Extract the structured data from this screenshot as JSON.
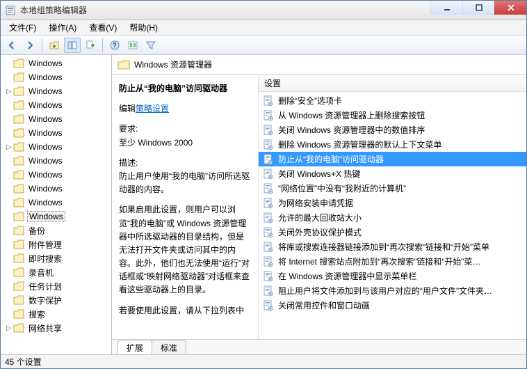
{
  "window": {
    "title": "本地组策略编辑器"
  },
  "menu": {
    "file": "文件(F)",
    "action": "操作(A)",
    "view": "查看(V)",
    "help": "帮助(H)"
  },
  "tree": {
    "items": [
      {
        "label": "Windows",
        "exp": ""
      },
      {
        "label": "Windows",
        "exp": ""
      },
      {
        "label": "Windows",
        "exp": "▷"
      },
      {
        "label": "Windows",
        "exp": ""
      },
      {
        "label": "Windows",
        "exp": ""
      },
      {
        "label": "Windows",
        "exp": ""
      },
      {
        "label": "Windows",
        "exp": "▷"
      },
      {
        "label": "Windows",
        "exp": ""
      },
      {
        "label": "Windows",
        "exp": ""
      },
      {
        "label": "Windows",
        "exp": ""
      },
      {
        "label": "Windows",
        "exp": ""
      },
      {
        "label": "Windows",
        "exp": "",
        "selected": true
      },
      {
        "label": "备份",
        "exp": ""
      },
      {
        "label": "附件管理",
        "exp": ""
      },
      {
        "label": "即时搜索",
        "exp": ""
      },
      {
        "label": "录音机",
        "exp": ""
      },
      {
        "label": "任务计划",
        "exp": ""
      },
      {
        "label": "数字保护",
        "exp": ""
      },
      {
        "label": "搜索",
        "exp": ""
      },
      {
        "label": "网络共享",
        "exp": "▷"
      }
    ]
  },
  "header": {
    "title": "Windows 资源管理器"
  },
  "desc": {
    "title": "防止从“我的电脑”访问驱动器",
    "edit_prefix": "编辑",
    "edit_link": "策略设置",
    "req_label": "要求:",
    "req_value": "至少 Windows 2000",
    "desc_label": "描述:",
    "desc_p1": "防止用户使用“我的电脑”访问所选驱动器的内容。",
    "desc_p2": "如果启用此设置，则用户可以浏览“我的电脑”或 Windows 资源管理器中所选驱动器的目录结构，但是无法打开文件夹或访问其中的内容。此外，他们也无法使用“运行”对话框或“映射网络驱动器”对话框来查看这些驱动器上的目录。",
    "desc_p3": "若要使用此设置，请从下拉列表中"
  },
  "list": {
    "col_header": "设置",
    "items": [
      "删除“安全”选项卡",
      "从 Windows 资源管理器上删除搜索按钮",
      "关闭 Windows 资源管理器中的数值排序",
      "删除 Windows 资源管理器的默认上下文菜单",
      "防止从“我的电脑”访问驱动器",
      "关闭 Windows+X 热键",
      "“网络位置”中没有“我附近的计算机”",
      "为网络安装申请凭据",
      "允许的最大回收站大小",
      "关闭外壳协议保护模式",
      "将库或搜索连接器链接添加到“再次搜索”链接和“开始”菜单",
      "将 Internet 搜索站点附加到“再次搜索”链接和“开始”菜…",
      "在 Windows 资源管理器中显示菜单栏",
      "阻止用户将文件添加到与该用户对应的“用户文件”文件夹…",
      "关闭常用控件和窗口动画"
    ],
    "selected_index": 4
  },
  "tabs": {
    "extended": "扩展",
    "standard": "标准"
  },
  "status": {
    "text": "45 个设置"
  }
}
